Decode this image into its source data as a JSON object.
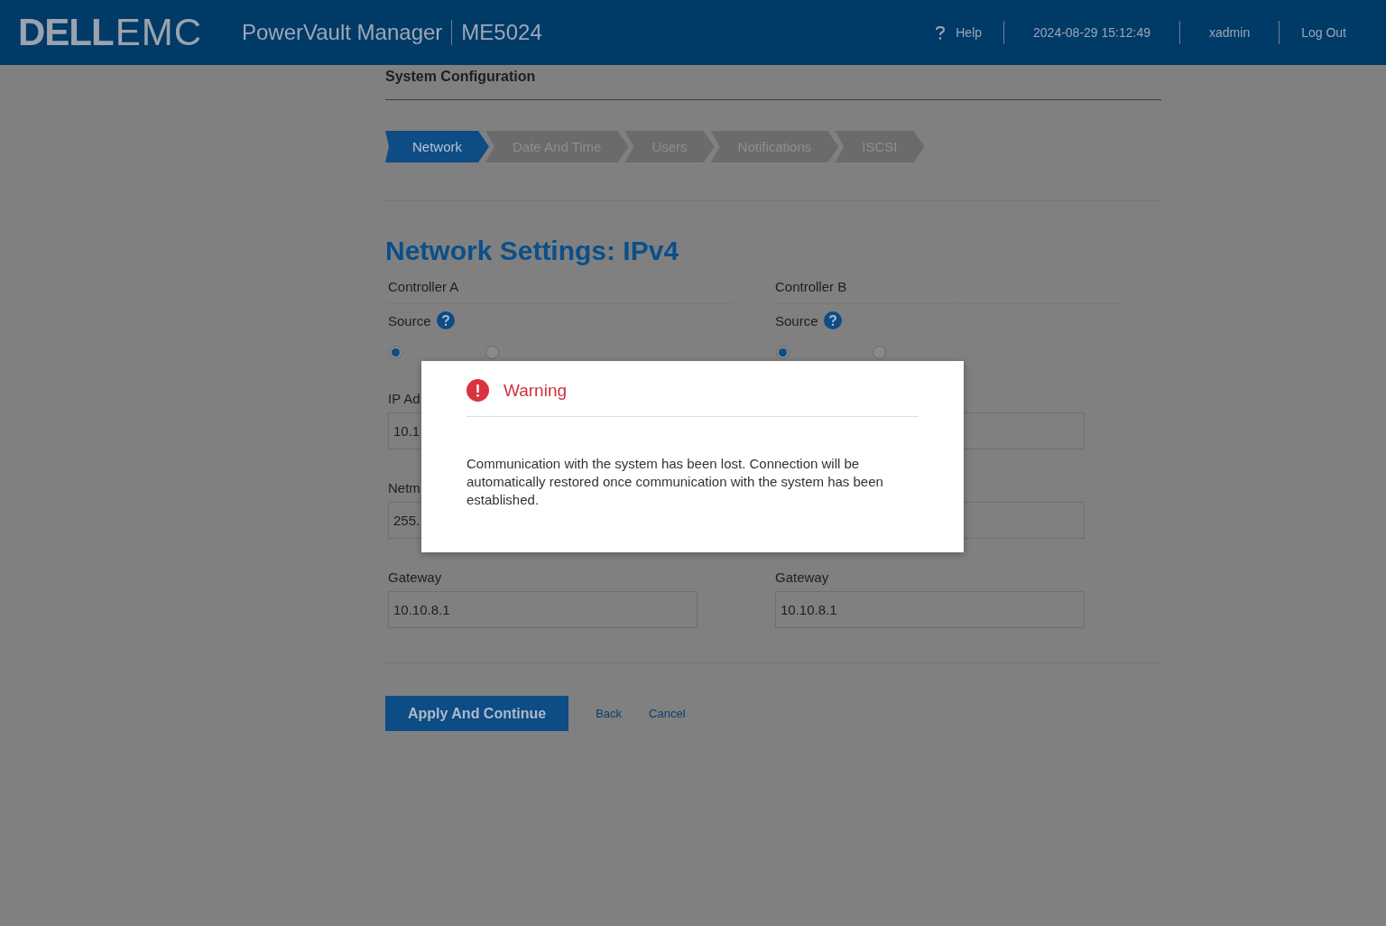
{
  "header": {
    "logo": {
      "brand": "DELL",
      "suffix": "EMC"
    },
    "product": "PowerVault Manager",
    "model": "ME5024",
    "help": "Help",
    "datetime": "2024-08-29 15:12:49",
    "user": "xadmin",
    "logout": "Log Out"
  },
  "page_title": "System Configuration",
  "steps": [
    {
      "label": "Network",
      "selected": true
    },
    {
      "label": "Date And Time",
      "selected": false
    },
    {
      "label": "Users",
      "selected": false
    },
    {
      "label": "Notifications",
      "selected": false
    },
    {
      "label": "ISCSI",
      "selected": false
    }
  ],
  "heading": "Network Settings: IPv4",
  "controllers": [
    {
      "title": "Controller A",
      "source_label": "Source",
      "radios": [
        {
          "selected": true
        },
        {
          "selected": false
        }
      ],
      "fields": [
        {
          "kind": "text",
          "label": "IP Ad",
          "value": "10.1"
        },
        {
          "kind": "text",
          "label": "Netm",
          "value": "255."
        },
        {
          "kind": "text",
          "label": "Gateway",
          "value": "10.10.8.1"
        }
      ]
    },
    {
      "title": "Controller B",
      "source_label": "Source",
      "radios": [
        {
          "selected": true
        },
        {
          "selected": false
        }
      ],
      "fields": [
        {
          "kind": "text"
        },
        {
          "kind": "text"
        },
        {
          "kind": "text",
          "label": "Gateway",
          "value": "10.10.8.1"
        }
      ]
    }
  ],
  "actions": {
    "primary": "Apply And Continue",
    "links": [
      "Back",
      "Cancel"
    ]
  },
  "modal": {
    "title": "Warning",
    "message": "Communication with the system has been lost. Connection will be automatically restored once communication with the system has been established."
  }
}
